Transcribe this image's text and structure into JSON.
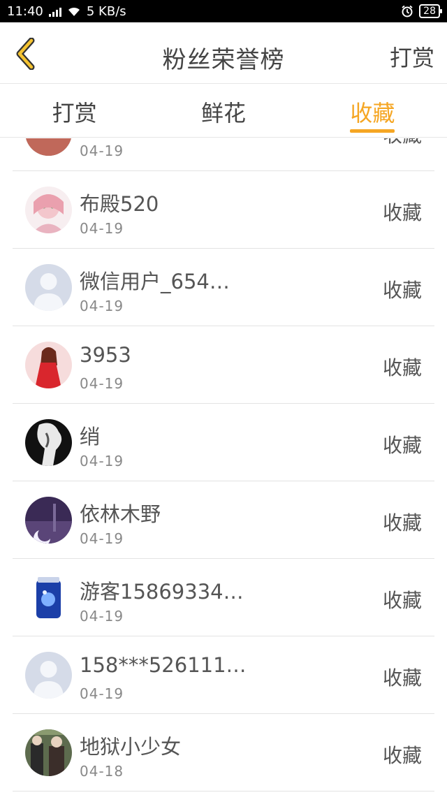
{
  "status_bar": {
    "time": "11:40",
    "network": "4G",
    "speed": "5 KB/s",
    "battery": "28"
  },
  "header": {
    "title": "粉丝荣誉榜",
    "action": "打赏",
    "back_icon": "chevron-left-icon",
    "accent": "#f5a623"
  },
  "tabs": [
    {
      "label": "打赏",
      "active": false
    },
    {
      "label": "鲜花",
      "active": false
    },
    {
      "label": "收藏",
      "active": true
    }
  ],
  "list": [
    {
      "name": "",
      "date": "04-19",
      "action": "收藏"
    },
    {
      "name": "布殿520",
      "date": "04-19",
      "action": "收藏"
    },
    {
      "name": "微信用户_654…",
      "date": "04-19",
      "action": "收藏"
    },
    {
      "name": "3953",
      "date": "04-19",
      "action": "收藏"
    },
    {
      "name": "绡",
      "date": "04-19",
      "action": "收藏"
    },
    {
      "name": "依林木野",
      "date": "04-19",
      "action": "收藏"
    },
    {
      "name": "游客15869334…",
      "date": "04-19",
      "action": "收藏"
    },
    {
      "name": "158***526111…",
      "date": "04-19",
      "action": "收藏"
    },
    {
      "name": "地狱小少女",
      "date": "04-18",
      "action": "收藏"
    }
  ]
}
